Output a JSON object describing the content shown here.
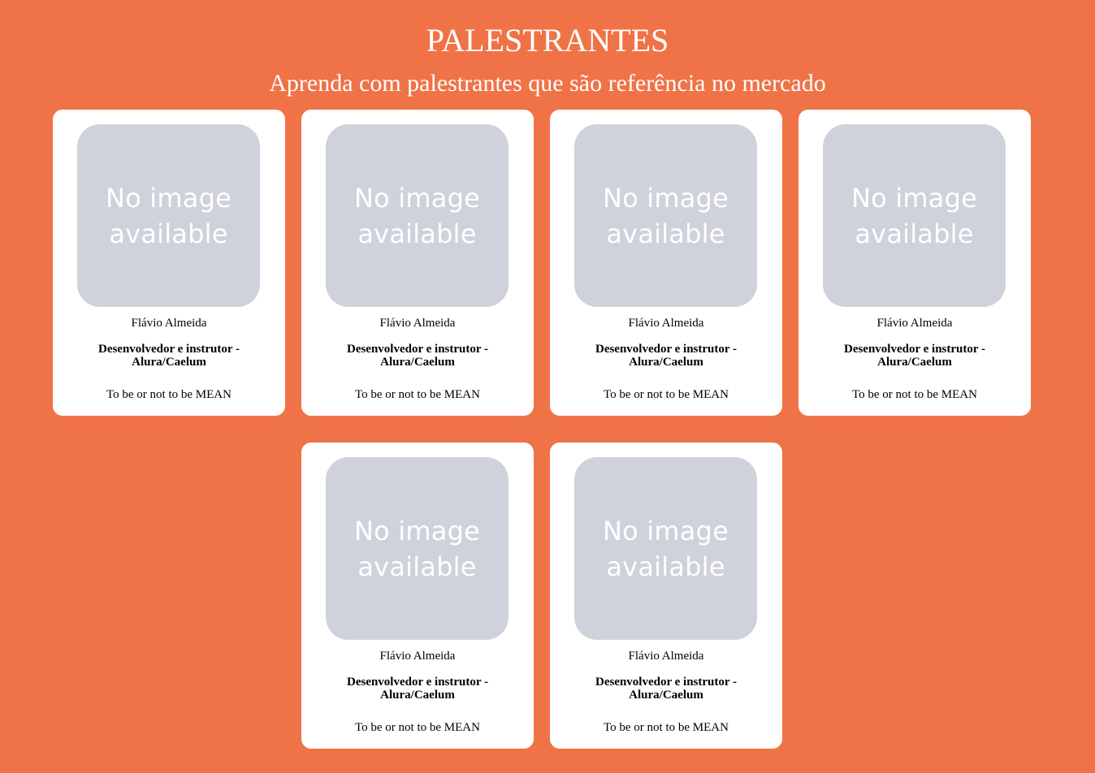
{
  "header": {
    "title": "PALESTRANTES",
    "subtitle": "Aprenda com palestrantes que são referência no mercado"
  },
  "speakers": [
    {
      "image_text": "No image available",
      "name": "Flávio Almeida",
      "role": "Desenvolvedor e instrutor - Alura/Caelum",
      "talk": "To be or not to be MEAN"
    },
    {
      "image_text": "No image available",
      "name": "Flávio Almeida",
      "role": "Desenvolvedor e instrutor - Alura/Caelum",
      "talk": "To be or not to be MEAN"
    },
    {
      "image_text": "No image available",
      "name": "Flávio Almeida",
      "role": "Desenvolvedor e instrutor - Alura/Caelum",
      "talk": "To be or not to be MEAN"
    },
    {
      "image_text": "No image available",
      "name": "Flávio Almeida",
      "role": "Desenvolvedor e instrutor - Alura/Caelum",
      "talk": "To be or not to be MEAN"
    },
    {
      "image_text": "No image available",
      "name": "Flávio Almeida",
      "role": "Desenvolvedor e instrutor - Alura/Caelum",
      "talk": "To be or not to be MEAN"
    },
    {
      "image_text": "No image available",
      "name": "Flávio Almeida",
      "role": "Desenvolvedor e instrutor - Alura/Caelum",
      "talk": "To be or not to be MEAN"
    }
  ],
  "colors": {
    "background": "#EF7347",
    "card": "#FFFFFF",
    "placeholder": "#CFD2DB"
  }
}
